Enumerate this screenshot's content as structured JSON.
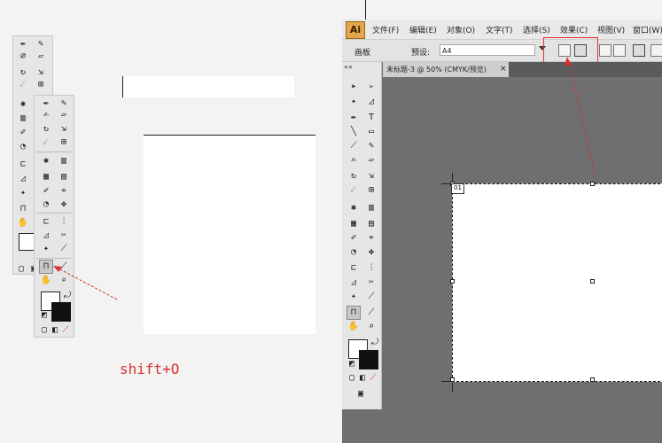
{
  "app": {
    "logo": "Ai",
    "menu": [
      "文件(F)",
      "编辑(E)",
      "对象(O)",
      "文字(T)",
      "选择(S)",
      "效果(C)",
      "视图(V)",
      "窗口(W)"
    ],
    "control_bar": {
      "label_left": "画板",
      "field_label": "预设:",
      "preset_value": "A4"
    },
    "document_tab": "未标题-3 @ 50% (CMYK/预览)",
    "tab_close": "×",
    "toolbar_collapse": "««",
    "artboard_number": "01"
  },
  "annotation": {
    "shortcut": "shift+O"
  },
  "colors": {
    "highlight": "#e23030",
    "workspace": "#6f6f6f",
    "logo": "#e2a74a"
  }
}
